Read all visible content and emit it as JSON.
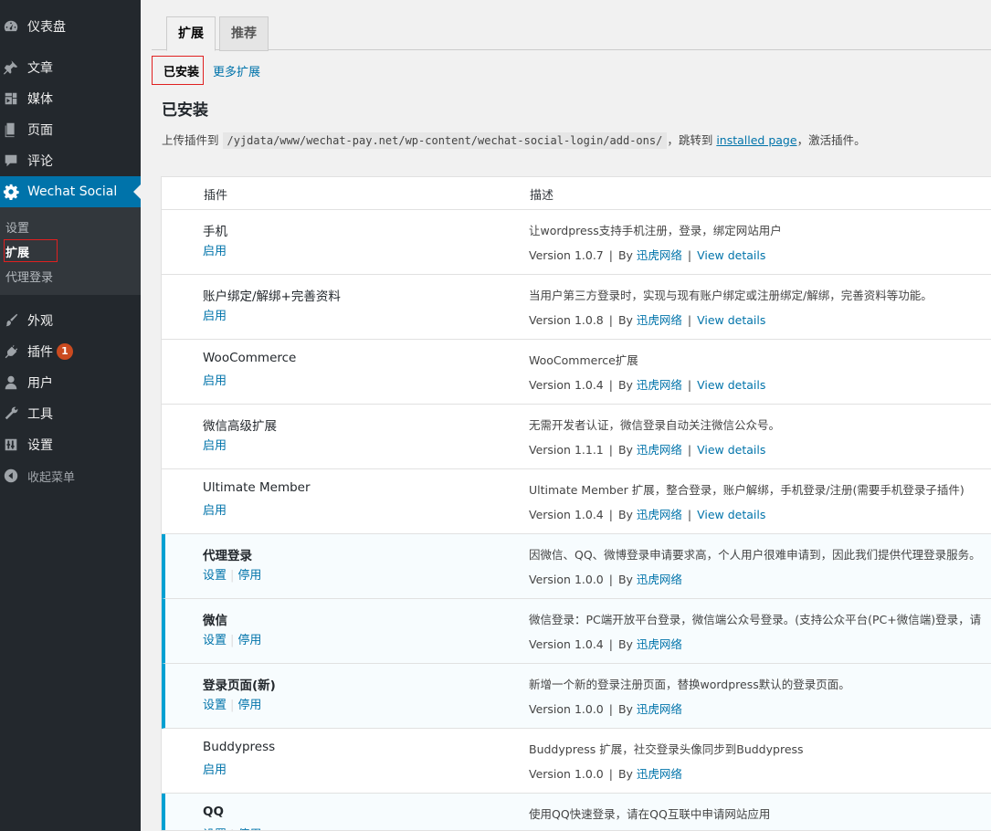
{
  "sidebar": {
    "items": [
      {
        "label": "仪表盘",
        "icon": "dashboard-icon"
      },
      {
        "label": "文章",
        "icon": "pin-icon"
      },
      {
        "label": "媒体",
        "icon": "media-icon"
      },
      {
        "label": "页面",
        "icon": "page-icon"
      },
      {
        "label": "评论",
        "icon": "comment-icon"
      },
      {
        "label": "Wechat Social",
        "icon": "gear-icon"
      },
      {
        "label": "外观",
        "icon": "brush-icon"
      },
      {
        "label": "插件",
        "icon": "plugin-icon",
        "badge": "1"
      },
      {
        "label": "用户",
        "icon": "user-icon"
      },
      {
        "label": "工具",
        "icon": "wrench-icon"
      },
      {
        "label": "设置",
        "icon": "settings-icon"
      },
      {
        "label": "收起菜单",
        "icon": "collapse-icon"
      }
    ],
    "submenu": [
      "设置",
      "扩展",
      "代理登录"
    ],
    "active_color": "#0073aa",
    "background": "#23282d"
  },
  "tabs": [
    "扩展",
    "推荐"
  ],
  "subsubsub": {
    "installed": "已安装",
    "more": "更多扩展"
  },
  "section_title": "已安装",
  "upload": {
    "prefix": "上传插件到",
    "path": "/yjdata/www/wechat-pay.net/wp-content/wechat-social-login/add-ons/",
    "middle": "，跳转到",
    "link": "installed page",
    "suffix": "，激活插件。"
  },
  "table": {
    "headers": [
      "插件",
      "描述"
    ],
    "rows": [
      {
        "name": "手机",
        "actions": [
          "启用"
        ],
        "desc": "让wordpress支持手机注册，登录，绑定网站用户",
        "version": "Version 1.0.7",
        "by": "By",
        "author": "迅虎网络",
        "details": "View details",
        "active": false
      },
      {
        "name": "账户绑定/解绑+完善资料",
        "actions": [
          "启用"
        ],
        "desc": "当用户第三方登录时，实现与现有账户绑定或注册绑定/解绑，完善资料等功能。",
        "version": "Version 1.0.8",
        "by": "By",
        "author": "迅虎网络",
        "details": "View details",
        "active": false
      },
      {
        "name": "WooCommerce",
        "actions": [
          "启用"
        ],
        "desc": "WooCommerce扩展",
        "version": "Version 1.0.4",
        "by": "By",
        "author": "迅虎网络",
        "details": "View details",
        "active": false
      },
      {
        "name": "微信高级扩展",
        "actions": [
          "启用"
        ],
        "desc": "无需开发者认证，微信登录自动关注微信公众号。",
        "version": "Version 1.1.1",
        "by": "By",
        "author": "迅虎网络",
        "details": "View details",
        "active": false
      },
      {
        "name": "Ultimate Member",
        "actions": [
          "启用"
        ],
        "desc": "Ultimate Member 扩展，整合登录，账户解绑，手机登录/注册(需要手机登录子插件)",
        "version": "Version 1.0.4",
        "by": "By",
        "author": "迅虎网络",
        "details": "View details",
        "active": false
      },
      {
        "name": "代理登录",
        "actions": [
          "设置",
          "停用"
        ],
        "desc": "因微信、QQ、微博登录申请要求高，个人用户很难申请到，因此我们提供代理登录服务。",
        "version": "Version 1.0.0",
        "by": "By",
        "author": "迅虎网络",
        "details": "",
        "active": true
      },
      {
        "name": "微信",
        "actions": [
          "设置",
          "停用"
        ],
        "desc": "微信登录：PC端开放平台登录，微信端公众号登录。(支持公众平台(PC+微信端)登录，请",
        "version": "Version 1.0.4",
        "by": "By",
        "author": "迅虎网络",
        "details": "",
        "active": true
      },
      {
        "name": "登录页面(新)",
        "actions": [
          "设置",
          "停用"
        ],
        "desc": "新增一个新的登录注册页面，替换wordpress默认的登录页面。",
        "version": "Version 1.0.0",
        "by": "By",
        "author": "迅虎网络",
        "details": "",
        "active": true
      },
      {
        "name": "Buddypress",
        "actions": [
          "启用"
        ],
        "desc": "Buddypress 扩展，社交登录头像同步到Buddypress",
        "version": "Version 1.0.0",
        "by": "By",
        "author": "迅虎网络",
        "details": "",
        "active": false
      },
      {
        "name": "QQ",
        "actions": [
          "设置",
          "停用"
        ],
        "desc": "使用QQ快速登录，请在QQ互联中申请网站应用",
        "version": "",
        "by": "",
        "author": "",
        "details": "",
        "active": true
      }
    ]
  }
}
